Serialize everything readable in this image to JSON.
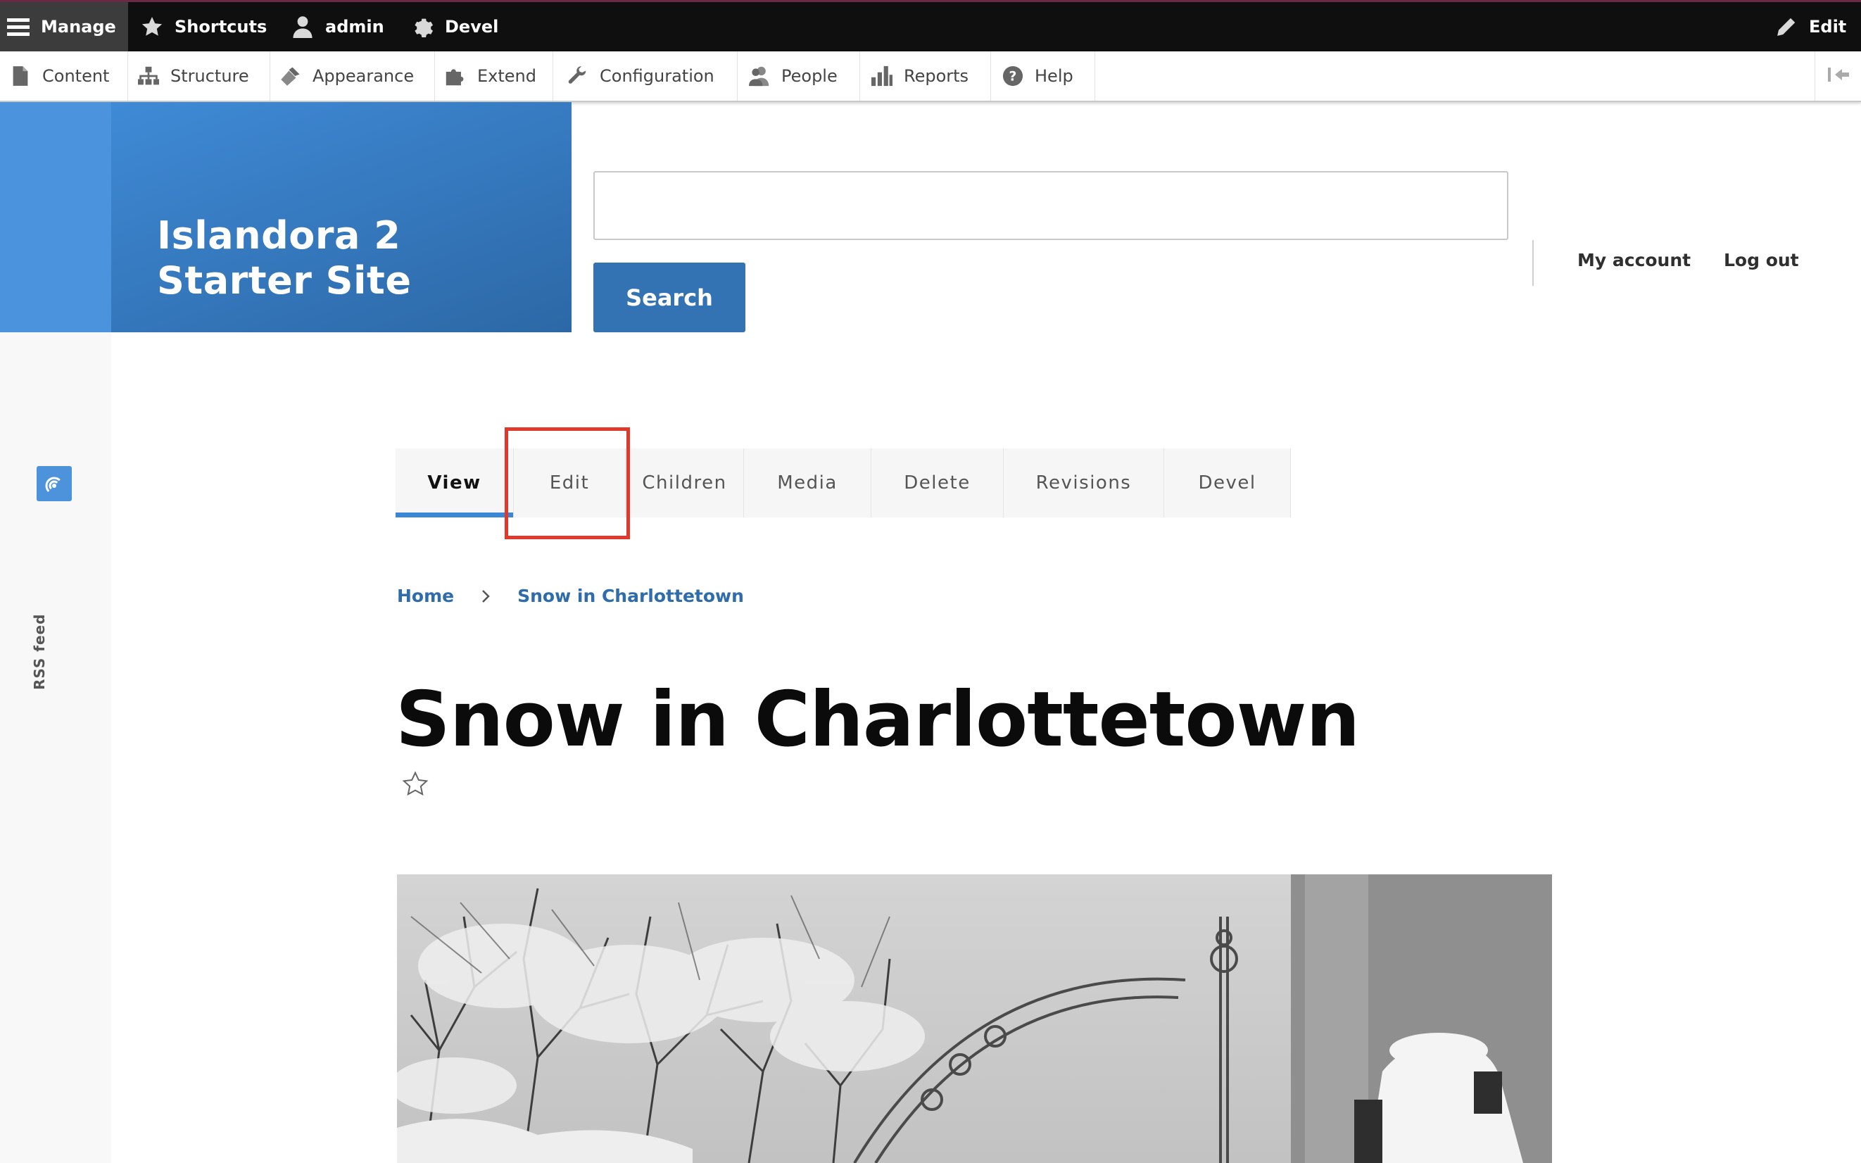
{
  "toolbar": {
    "manage_label": "Manage",
    "shortcuts_label": "Shortcuts",
    "user_label": "admin",
    "devel_label": "Devel",
    "edit_label": "Edit"
  },
  "tray": {
    "items": [
      {
        "label": "Content",
        "icon": "file-icon"
      },
      {
        "label": "Structure",
        "icon": "sitemap-icon"
      },
      {
        "label": "Appearance",
        "icon": "paintbrush-icon"
      },
      {
        "label": "Extend",
        "icon": "puzzle-icon"
      },
      {
        "label": "Configuration",
        "icon": "wrench-icon"
      },
      {
        "label": "People",
        "icon": "people-icon"
      },
      {
        "label": "Reports",
        "icon": "bar-chart-icon"
      },
      {
        "label": "Help",
        "icon": "question-icon"
      }
    ]
  },
  "site": {
    "name_line1": "Islandora 2",
    "name_line2": "Starter Site"
  },
  "search": {
    "button_label": "Search",
    "placeholder": ""
  },
  "account_menu": {
    "my_account": "My account",
    "log_out": "Log out"
  },
  "sidebar": {
    "rss_label": "RSS feed"
  },
  "tabs": [
    {
      "label": "View",
      "active": true
    },
    {
      "label": "Edit",
      "active": false
    },
    {
      "label": "Children",
      "active": false
    },
    {
      "label": "Media",
      "active": false
    },
    {
      "label": "Delete",
      "active": false
    },
    {
      "label": "Revisions",
      "active": false
    },
    {
      "label": "Devel",
      "active": false
    }
  ],
  "breadcrumb": {
    "home": "Home",
    "current": "Snow in Charlottetown"
  },
  "page": {
    "title": "Snow in Charlottetown"
  },
  "colors": {
    "admin_bar": "#0f0f0f",
    "brand_blue": "#3473b3",
    "tab_active_underline": "#3a87d6",
    "highlight": "#e0392b"
  }
}
